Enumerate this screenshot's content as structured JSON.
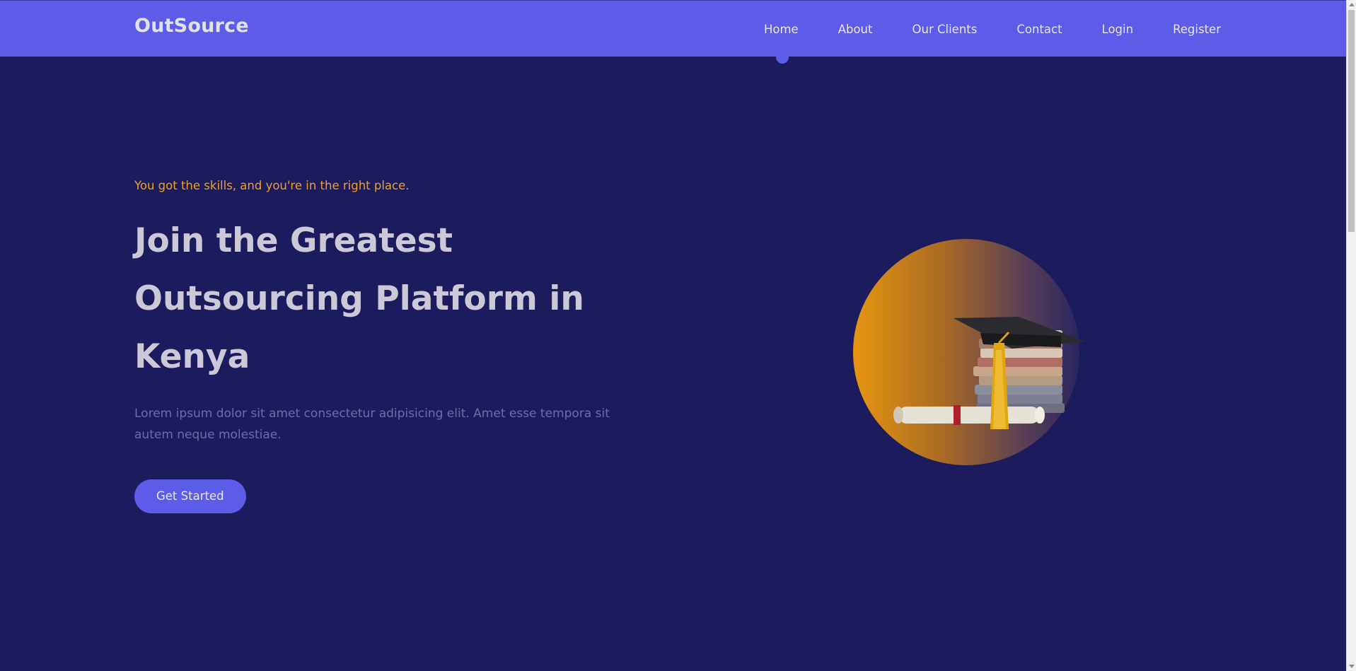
{
  "brand": "OutSource",
  "nav": {
    "items": [
      "Home",
      "About",
      "Our Clients",
      "Contact",
      "Login",
      "Register"
    ],
    "active": "Home"
  },
  "hero": {
    "tagline": "You got the skills, and you're in the right place.",
    "headline": "Join the Greatest Outsourcing Platform in Kenya",
    "description": "Lorem ipsum dolor sit amet consectetur adipisicing elit. Amet esse tempora sit autem neque molestiae.",
    "cta_label": "Get Started"
  },
  "colors": {
    "navbar": "#5c5ce8",
    "background": "#1b1b5e",
    "accent": "#f0a020"
  },
  "image": {
    "subject": "graduation-cap-books-diploma"
  }
}
